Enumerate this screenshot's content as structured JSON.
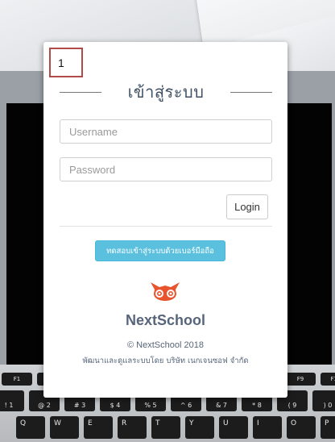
{
  "step_marker": "1",
  "login": {
    "title": "เข้าสู่ระบบ",
    "username_placeholder": "Username",
    "password_placeholder": "Password",
    "login_label": "Login",
    "phone_login_label": "ทดสอบเข้าสู่ระบบด้วยเบอร์มือถือ"
  },
  "brand": {
    "logo_icon": "owl-icon",
    "logo_color": "#e8542e",
    "name": "NextSchool",
    "copyright": "© NextSchool 2018",
    "developer": "พัฒนาและดูแลระบบโดย บริษัท เนกเจนซอฟ จำกัด"
  },
  "keyboard": {
    "function_row": [
      "F1",
      "F2",
      "F3",
      "F4",
      "F5",
      "F6",
      "F7",
      "F8",
      "F9",
      "F10"
    ],
    "number_row": [
      "!\n1",
      "@\n2",
      "#\n3",
      "$\n4",
      "%\n5",
      "^\n6",
      "&\n7",
      "*\n8",
      "(\n9",
      ")\n0"
    ],
    "letter_row": [
      "Q",
      "W",
      "E",
      "R",
      "T",
      "Y",
      "U",
      "I",
      "O",
      "P"
    ]
  },
  "colors": {
    "accent_info": "#5bc0de",
    "title_color": "#3f5064",
    "marker_border": "#b14a49"
  }
}
